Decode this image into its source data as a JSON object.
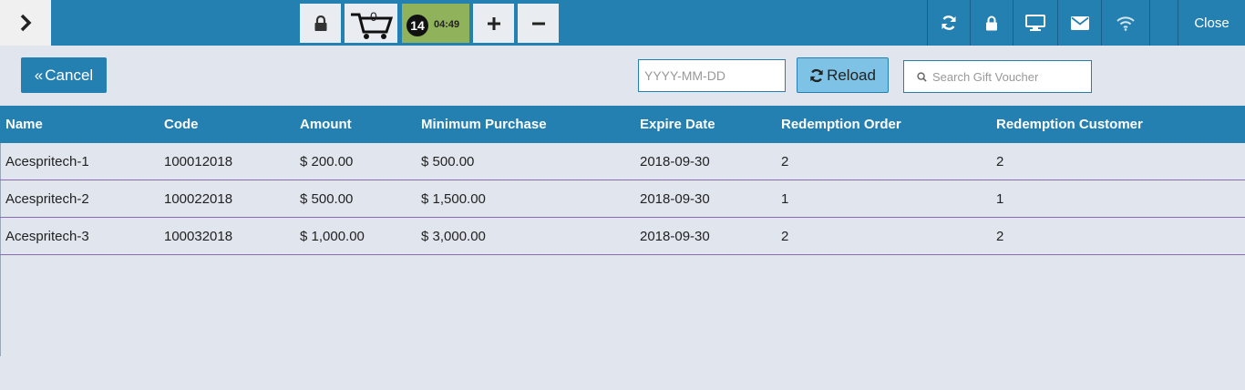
{
  "topbar": {
    "cart_count": "0",
    "timer_badge": "14",
    "timer_time": "04:49",
    "close_label": "Close"
  },
  "toolbar": {
    "cancel_label": "Cancel",
    "date_placeholder": "YYYY-MM-DD",
    "reload_label": "Reload",
    "search_placeholder": "Search Gift Voucher"
  },
  "table": {
    "headers": [
      "Name",
      "Code",
      "Amount",
      "Minimum Purchase",
      "Expire Date",
      "Redemption Order",
      "Redemption Customer"
    ],
    "rows": [
      [
        "Acespritech-1",
        "100012018",
        "$ 200.00",
        "$ 500.00",
        "2018-09-30",
        "2",
        "2"
      ],
      [
        "Acespritech-2",
        "100022018",
        "$ 500.00",
        "$ 1,500.00",
        "2018-09-30",
        "1",
        "1"
      ],
      [
        "Acespritech-3",
        "100032018",
        "$ 1,000.00",
        "$ 3,000.00",
        "2018-09-30",
        "2",
        "2"
      ]
    ]
  },
  "colors": {
    "primary": "#2580b2",
    "timer_bg": "#8fb25a",
    "reload_bg": "#7ec3e6",
    "background": "#e1e6ee"
  },
  "icons": [
    "chevron-right-icon",
    "lock-icon",
    "cart-icon",
    "plus-icon",
    "minus-icon",
    "sync-icon",
    "monitor-icon",
    "mail-icon",
    "wifi-icon",
    "double-chevron-left-icon",
    "refresh-icon",
    "search-icon"
  ]
}
